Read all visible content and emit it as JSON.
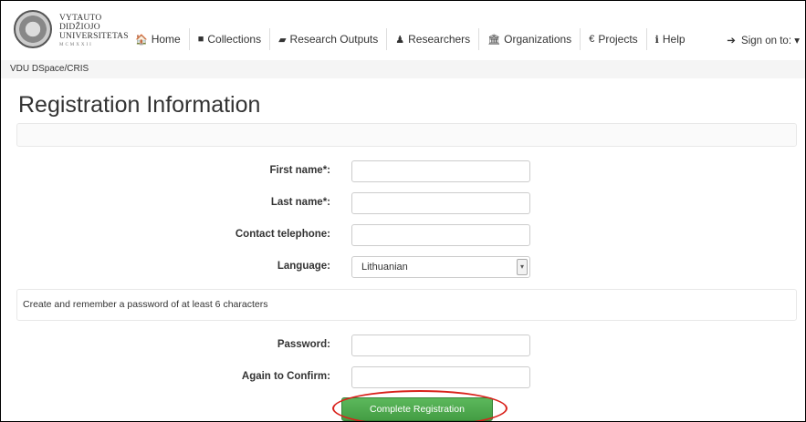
{
  "logo": {
    "line1": "VYTAUTO",
    "line2": "DIDŽIOJO",
    "line3": "UNIVERSITETAS",
    "line4": "MCMXXII"
  },
  "nav": {
    "items": [
      {
        "label": "Home",
        "icon": "home-icon",
        "glyph": "🏠"
      },
      {
        "label": "Collections",
        "icon": "folder-icon",
        "glyph": "■"
      },
      {
        "label": "Research Outputs",
        "icon": "book-icon",
        "glyph": "▰"
      },
      {
        "label": "Researchers",
        "icon": "user-icon",
        "glyph": "♟"
      },
      {
        "label": "Organizations",
        "icon": "institution-icon",
        "glyph": "🏛"
      },
      {
        "label": "Projects",
        "icon": "euro-icon",
        "glyph": "€"
      },
      {
        "label": "Help",
        "icon": "info-icon",
        "glyph": "ℹ"
      }
    ],
    "signon": "Sign on to:",
    "signon_glyph": "➔",
    "signon_caret": "▾"
  },
  "breadcrumb": "VDU DSpace/CRIS",
  "page_title": "Registration Information",
  "form": {
    "first_name_label": "First name*:",
    "first_name_value": "",
    "last_name_label": "Last name*:",
    "last_name_value": "",
    "phone_label": "Contact telephone:",
    "phone_value": "",
    "language_label": "Language:",
    "language_value": "Lithuanian",
    "password_hint": "Create and remember a password of at least 6 characters",
    "password_label": "Password:",
    "password_value": "",
    "confirm_label": "Again to Confirm:",
    "confirm_value": "",
    "submit_label": "Complete Registration"
  },
  "accent": {
    "button_green": "#5cb85c",
    "highlight_red": "#d9211b"
  }
}
